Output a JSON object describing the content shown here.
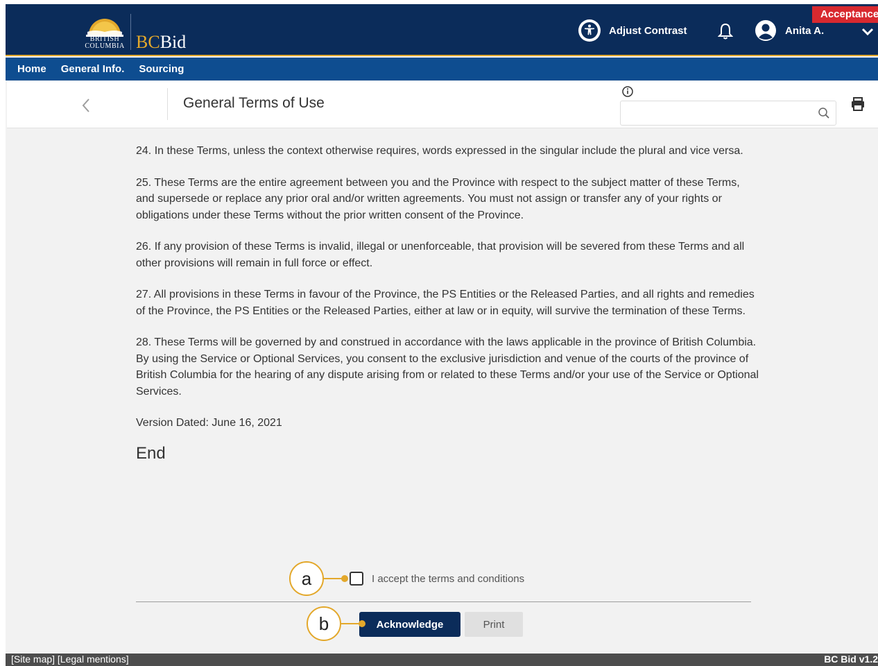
{
  "header": {
    "logo_text_line1": "BRITISH",
    "logo_text_line2": "COLUMBIA",
    "brand_bc": "BC",
    "brand_bid": "Bid",
    "adjust_contrast": "Adjust Contrast",
    "user_name": "Anita A.",
    "environment_badge": "Acceptance"
  },
  "nav": {
    "items": [
      "Home",
      "General Info.",
      "Sourcing"
    ]
  },
  "page": {
    "title": "General Terms of Use",
    "search_placeholder": ""
  },
  "terms": {
    "paragraphs": [
      "24. In these Terms, unless the context otherwise requires, words expressed in the singular include the plural and vice versa.",
      "25. These Terms are the entire agreement between you and the Province with respect to the subject matter of these Terms, and supersede or replace any prior oral and/or written agreements.  You must not assign or transfer any of your rights or obligations under these Terms without the prior written consent of the Province.",
      "26. If any provision of these Terms is invalid, illegal or unenforceable, that provision will be severed from these Terms and all other provisions will remain in full force or effect.",
      "27. All provisions in these Terms in favour of the Province, the PS Entities or the Released Parties, and all rights and remedies of the Province, the PS Entities or the Released Parties, either at law or in equity, will survive the termination of these Terms.",
      "28. These Terms will be governed by and construed in accordance with the laws applicable in the province of British Columbia.  By using the Service or Optional Services, you consent to the exclusive jurisdiction and venue of the courts of the province of British Columbia for the hearing of any dispute arising from or related to these Terms and/or your use of the Service or Optional Services."
    ],
    "version": "Version Dated:  June 16, 2021",
    "end": "End"
  },
  "accept": {
    "checkbox_label": "I accept the terms and conditions",
    "checked": false
  },
  "buttons": {
    "acknowledge": "Acknowledge",
    "print": "Print"
  },
  "callouts": {
    "a": "a",
    "b": "b"
  },
  "footer": {
    "links": "[Site map] [Legal mentions]",
    "version": "BC Bid v1.2"
  },
  "colors": {
    "header_navy": "#0b2c5a",
    "nav_blue": "#0e4d90",
    "gold": "#e3a82b",
    "badge_red": "#d8292f"
  },
  "icons": [
    "accessibility-icon",
    "bell-icon",
    "user-avatar-icon",
    "chevron-down-icon",
    "chevron-left-icon",
    "info-icon",
    "search-icon",
    "printer-icon",
    "bc-sun-logo"
  ]
}
